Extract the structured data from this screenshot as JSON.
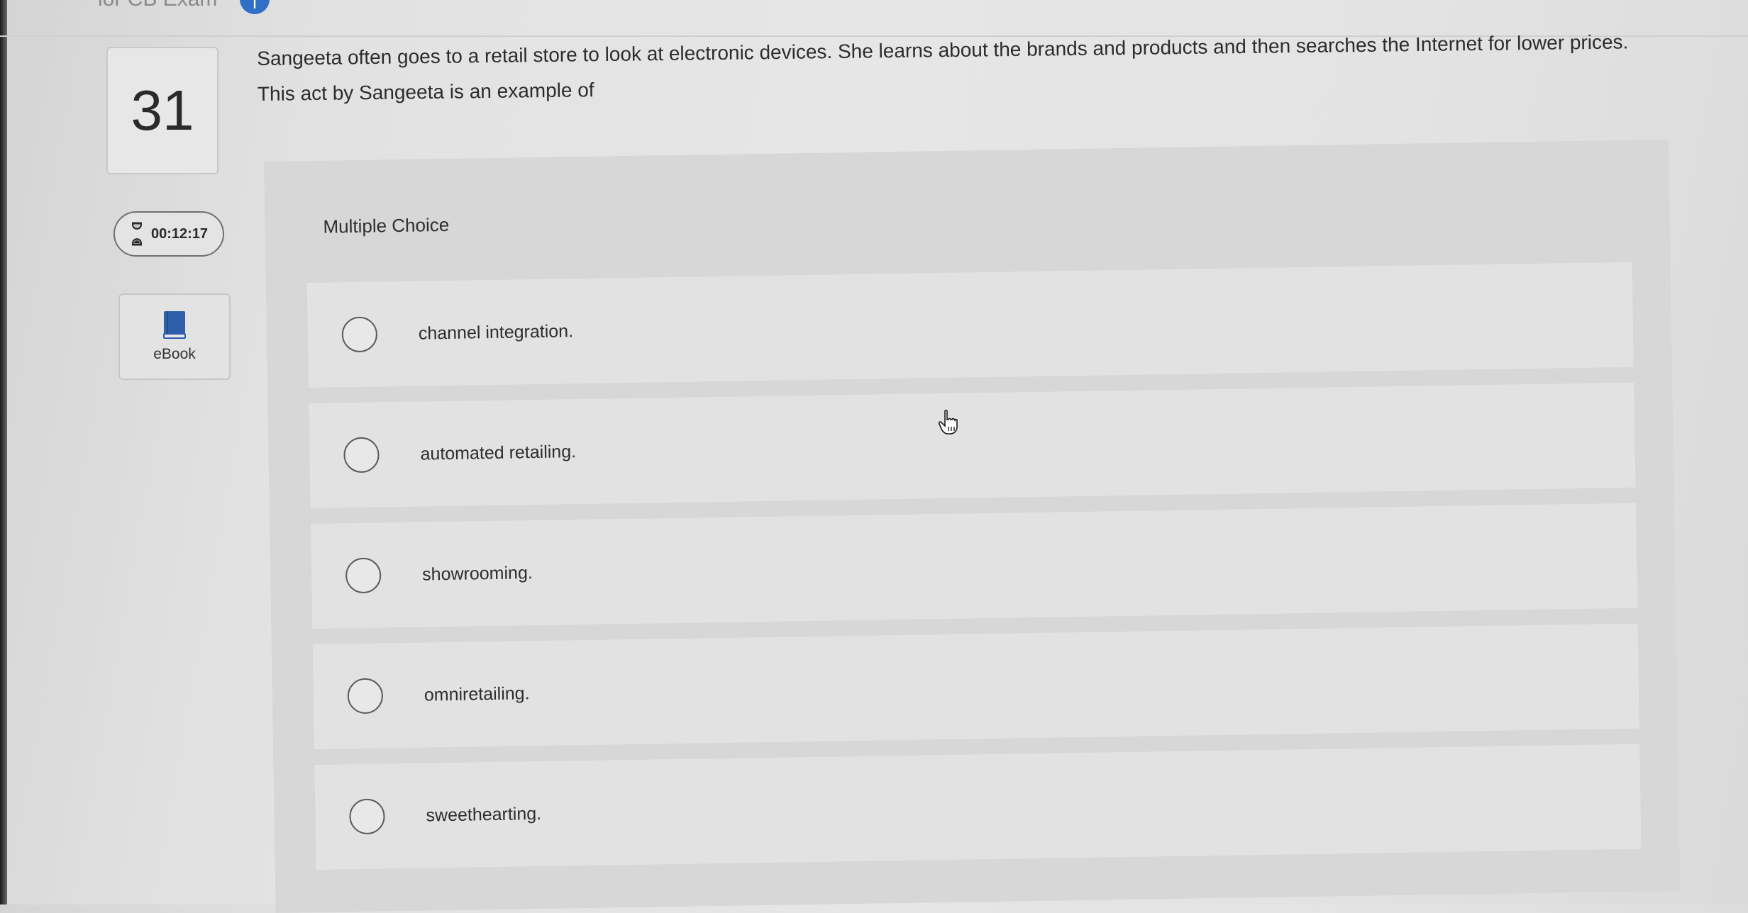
{
  "header": {
    "title": "ior CB Exam",
    "info_icon": "info-icon"
  },
  "question": {
    "number": "31",
    "text": "Sangeeta often goes to a retail store to look at electronic devices. She learns about the brands and products and then searches the Internet for lower prices. This act by Sangeeta is an example of"
  },
  "timer": {
    "icon": "hourglass-icon",
    "value": "00:12:17"
  },
  "ebook": {
    "icon": "book-icon",
    "label": "eBook"
  },
  "multiple_choice": {
    "label": "Multiple Choice",
    "options": [
      {
        "label": "channel integration."
      },
      {
        "label": "automated retailing."
      },
      {
        "label": "showrooming."
      },
      {
        "label": "omniretailing."
      },
      {
        "label": "sweethearting."
      }
    ]
  },
  "colors": {
    "accent": "#2f6fc6",
    "book": "#2f5fa8"
  },
  "cursor": "hand-pointer-icon"
}
